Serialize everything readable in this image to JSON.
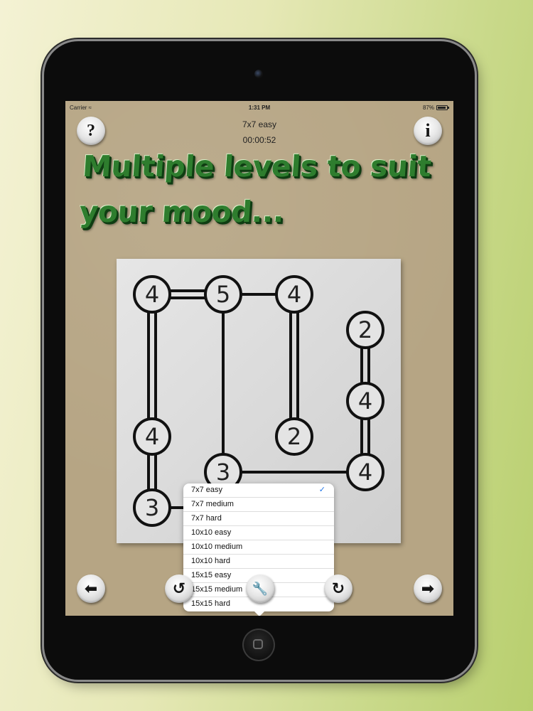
{
  "statusbar": {
    "carrier": "Carrier",
    "time": "1:31 PM",
    "battery": "87%"
  },
  "header": {
    "level": "7x7 easy",
    "timer": "00:00:52"
  },
  "promo": {
    "line1": "Multiple levels to suit",
    "line2": "your mood..."
  },
  "buttons": {
    "help": "?",
    "info": "i",
    "prev": "⬅",
    "undo": "↺",
    "settings": "🔧",
    "redo": "↻",
    "next": "➡"
  },
  "board": {
    "islands": [
      {
        "col": 0,
        "row": 0,
        "value": "4"
      },
      {
        "col": 1,
        "row": 0,
        "value": "5"
      },
      {
        "col": 2,
        "row": 0,
        "value": "4"
      },
      {
        "col": 3,
        "row": 1,
        "value": "2"
      },
      {
        "col": 3,
        "row": 2,
        "value": "4"
      },
      {
        "col": 0,
        "row": 3,
        "value": "4"
      },
      {
        "col": 2,
        "row": 3,
        "value": "2"
      },
      {
        "col": 1,
        "row": 4,
        "value": "3"
      },
      {
        "col": 3,
        "row": 4,
        "value": "4"
      },
      {
        "col": 0,
        "row": 5,
        "value": "3"
      },
      {
        "col": 2,
        "row": 5,
        "value": ""
      }
    ],
    "bridges": [
      {
        "from": 0,
        "to": 1,
        "count": 2
      },
      {
        "from": 1,
        "to": 2,
        "count": 1
      },
      {
        "from": 0,
        "to": 5,
        "count": 2
      },
      {
        "from": 1,
        "to": 7,
        "count": 1
      },
      {
        "from": 2,
        "to": 6,
        "count": 2
      },
      {
        "from": 3,
        "to": 4,
        "count": 2
      },
      {
        "from": 4,
        "to": 8,
        "count": 2
      },
      {
        "from": 7,
        "to": 8,
        "count": 1
      },
      {
        "from": 5,
        "to": 9,
        "count": 2
      },
      {
        "from": 9,
        "to": 10,
        "count": 1
      }
    ]
  },
  "levels": {
    "selected": "7x7 easy",
    "check": "✓",
    "options": [
      "7x7 easy",
      "7x7 medium",
      "7x7 hard",
      "10x10 easy",
      "10x10 medium",
      "10x10 hard",
      "15x15 easy",
      "15x15 medium",
      "15x15 hard"
    ]
  }
}
